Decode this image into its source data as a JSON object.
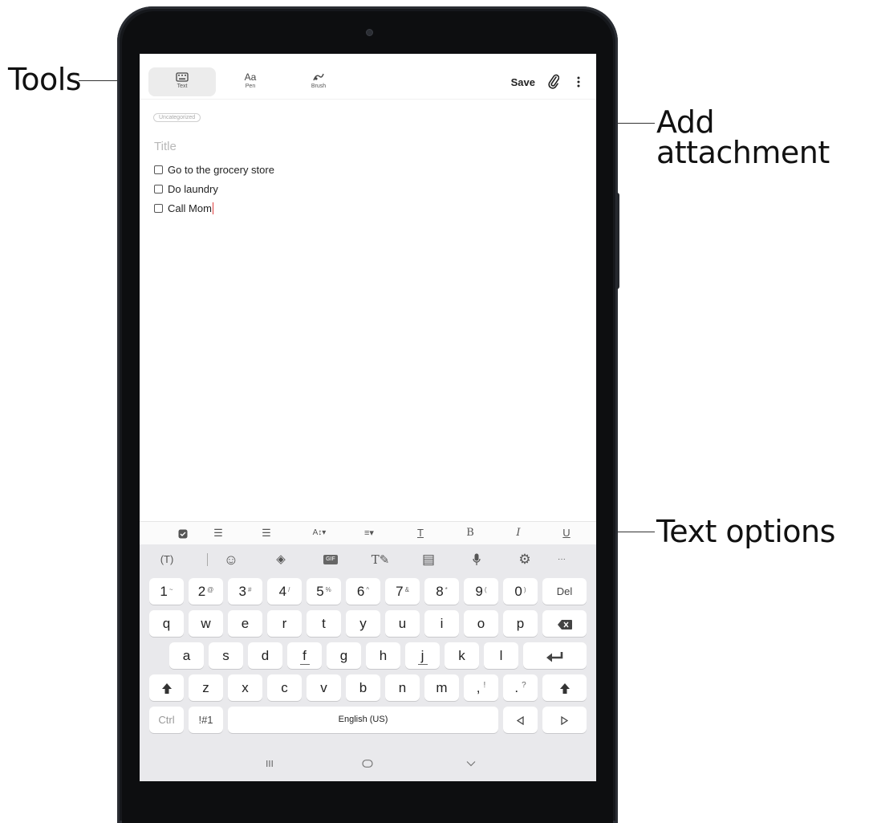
{
  "callouts": {
    "tools": "Tools",
    "add_attachment": "Add attachment",
    "text_options": "Text options"
  },
  "toolbar": {
    "tools": [
      {
        "label": "Text",
        "icon": "keyboard-icon"
      },
      {
        "label": "Pen",
        "icon": "pen-text-icon"
      },
      {
        "label": "Brush",
        "icon": "brush-icon"
      }
    ],
    "save_label": "Save",
    "attach_icon": "paperclip-icon",
    "more_icon": "more-vertical-icon"
  },
  "note": {
    "category": "Uncategorized",
    "title_placeholder": "Title",
    "items": [
      "Go to the grocery store",
      "Do laundry",
      "Call Mom"
    ]
  },
  "text_options": [
    {
      "name": "checkbox-list-icon",
      "glyph": "☑"
    },
    {
      "name": "numbered-list-icon",
      "glyph": "☰"
    },
    {
      "name": "bulleted-list-icon",
      "glyph": "☰"
    },
    {
      "name": "font-size-icon",
      "glyph": "A↕▾"
    },
    {
      "name": "align-icon",
      "glyph": "≡▾"
    },
    {
      "name": "text-color-icon",
      "glyph": "T"
    },
    {
      "name": "bold-icon",
      "glyph": "B"
    },
    {
      "name": "italic-icon",
      "glyph": "I"
    },
    {
      "name": "underline-icon",
      "glyph": "U"
    }
  ],
  "keyboard": {
    "toolbar": [
      {
        "name": "translate-icon",
        "glyph": "(T)"
      },
      {
        "name": "emoji-icon",
        "glyph": "☺"
      },
      {
        "name": "sticker-icon",
        "glyph": "◈"
      },
      {
        "name": "gif-icon",
        "glyph": "GIF"
      },
      {
        "name": "handwriting-icon",
        "glyph": "T✎"
      },
      {
        "name": "clipboard-icon",
        "glyph": "▤"
      },
      {
        "name": "microphone-icon",
        "glyph": "🎙"
      },
      {
        "name": "settings-icon",
        "glyph": "⚙"
      },
      {
        "name": "more-horizontal-icon",
        "glyph": "···"
      }
    ],
    "row1": [
      {
        "k": "1",
        "s": "~"
      },
      {
        "k": "2",
        "s": "@"
      },
      {
        "k": "3",
        "s": "#"
      },
      {
        "k": "4",
        "s": "/"
      },
      {
        "k": "5",
        "s": "%"
      },
      {
        "k": "6",
        "s": "^"
      },
      {
        "k": "7",
        "s": "&"
      },
      {
        "k": "8",
        "s": "*"
      },
      {
        "k": "9",
        "s": "("
      },
      {
        "k": "0",
        "s": ")"
      }
    ],
    "del": "Del",
    "row2": [
      "q",
      "w",
      "e",
      "r",
      "t",
      "y",
      "u",
      "i",
      "o",
      "p"
    ],
    "row3": [
      "a",
      "s",
      "d",
      "f",
      "g",
      "h",
      "j",
      "k",
      "l"
    ],
    "row4": [
      "z",
      "x",
      "c",
      "v",
      "b",
      "n",
      "m"
    ],
    "comma": {
      "k": ",",
      "s": "!"
    },
    "period": {
      "k": ".",
      "s": "?"
    },
    "ctrl": "Ctrl",
    "symbols": "!#1",
    "space": "English (US)"
  }
}
